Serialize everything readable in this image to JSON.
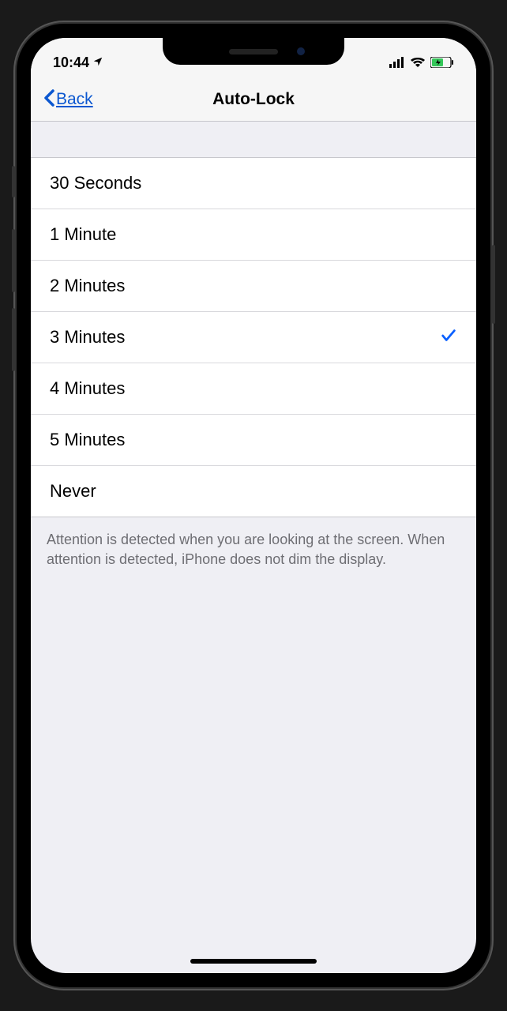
{
  "status": {
    "time": "10:44",
    "location_active": true
  },
  "nav": {
    "back_label": "Back",
    "title": "Auto-Lock"
  },
  "options": [
    {
      "label": "30 Seconds",
      "selected": false
    },
    {
      "label": "1 Minute",
      "selected": false
    },
    {
      "label": "2 Minutes",
      "selected": false
    },
    {
      "label": "3 Minutes",
      "selected": true
    },
    {
      "label": "4 Minutes",
      "selected": false
    },
    {
      "label": "5 Minutes",
      "selected": false
    },
    {
      "label": "Never",
      "selected": false
    }
  ],
  "footer": "Attention is detected when you are looking at the screen. When attention is detected, iPhone does not dim the display."
}
